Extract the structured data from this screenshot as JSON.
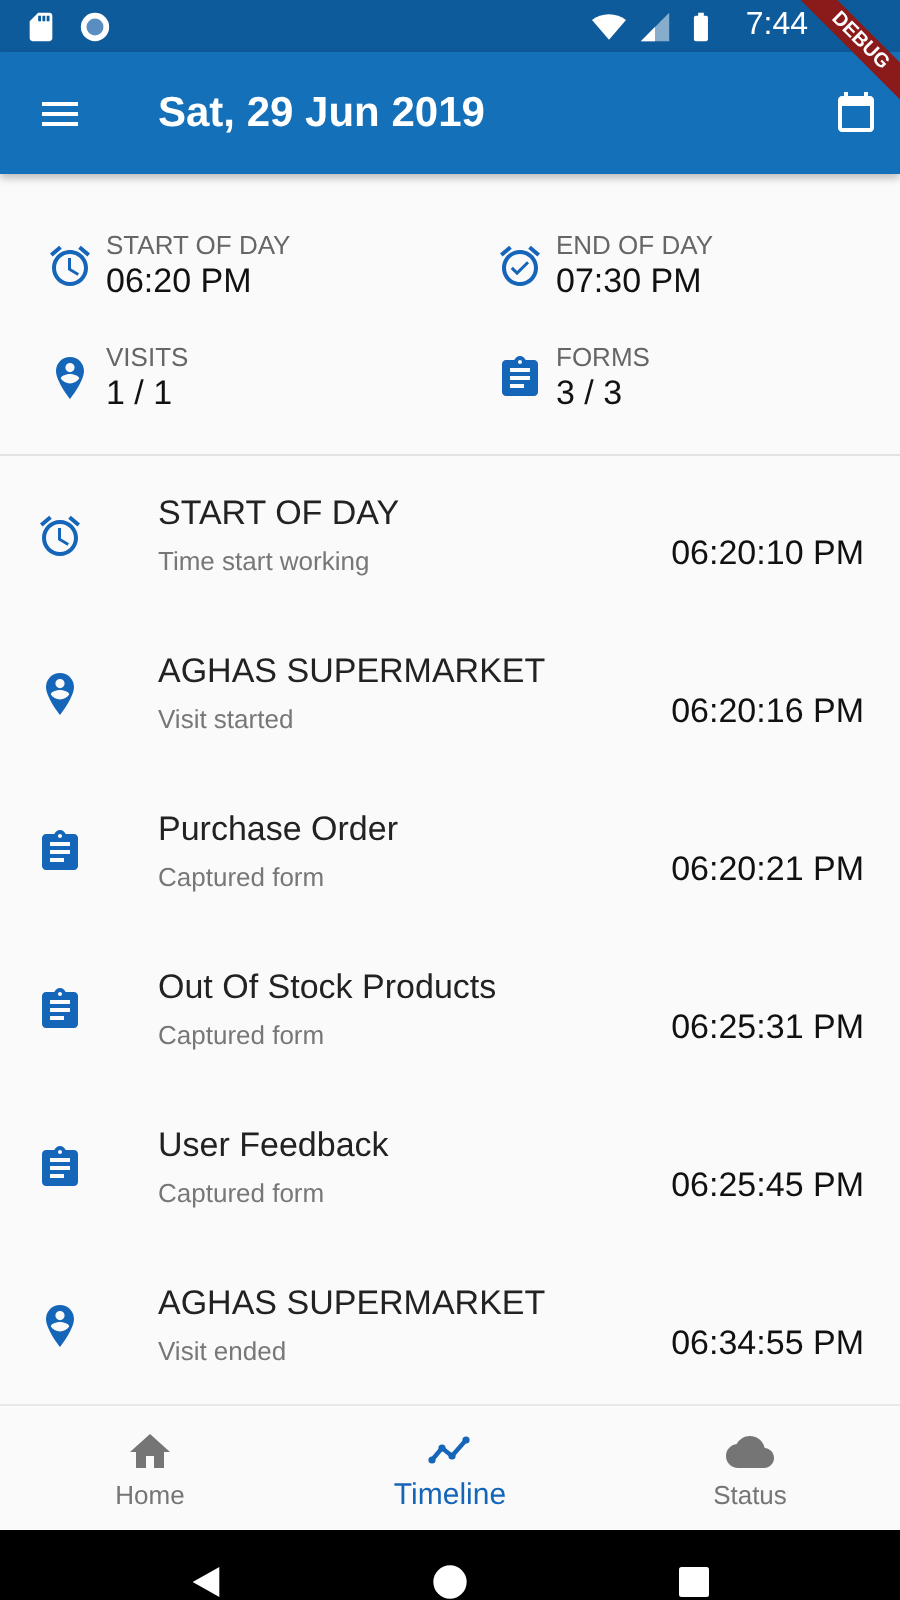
{
  "status_bar": {
    "time": "7:44"
  },
  "debug_banner": "DEBUG",
  "app_bar": {
    "title": "Sat, 29 Jun 2019"
  },
  "summary": [
    {
      "kind": "alarm",
      "label": "START OF DAY",
      "value": "06:20 PM"
    },
    {
      "kind": "alarm-check",
      "label": "END OF DAY",
      "value": "07:30 PM"
    },
    {
      "kind": "pin",
      "label": "VISITS",
      "value": "1 / 1"
    },
    {
      "kind": "clipboard",
      "label": "FORMS",
      "value": "3 / 3"
    }
  ],
  "timeline": [
    {
      "kind": "alarm",
      "title": "START OF DAY",
      "subtitle": "Time start working",
      "time": "06:20:10 PM"
    },
    {
      "kind": "pin",
      "title": "AGHAS SUPERMARKET",
      "subtitle": "Visit started",
      "time": "06:20:16 PM"
    },
    {
      "kind": "clipboard",
      "title": "Purchase Order",
      "subtitle": "Captured form",
      "time": "06:20:21 PM"
    },
    {
      "kind": "clipboard",
      "title": "Out Of Stock Products",
      "subtitle": "Captured form",
      "time": "06:25:31 PM"
    },
    {
      "kind": "clipboard",
      "title": "User Feedback",
      "subtitle": "Captured form",
      "time": "06:25:45 PM"
    },
    {
      "kind": "pin",
      "title": "AGHAS SUPERMARKET",
      "subtitle": "Visit ended",
      "time": "06:34:55 PM"
    }
  ],
  "bottom_nav": [
    {
      "kind": "home",
      "label": "Home",
      "selected": false
    },
    {
      "kind": "timeline",
      "label": "Timeline",
      "selected": true
    },
    {
      "kind": "cloud",
      "label": "Status",
      "selected": false
    }
  ]
}
